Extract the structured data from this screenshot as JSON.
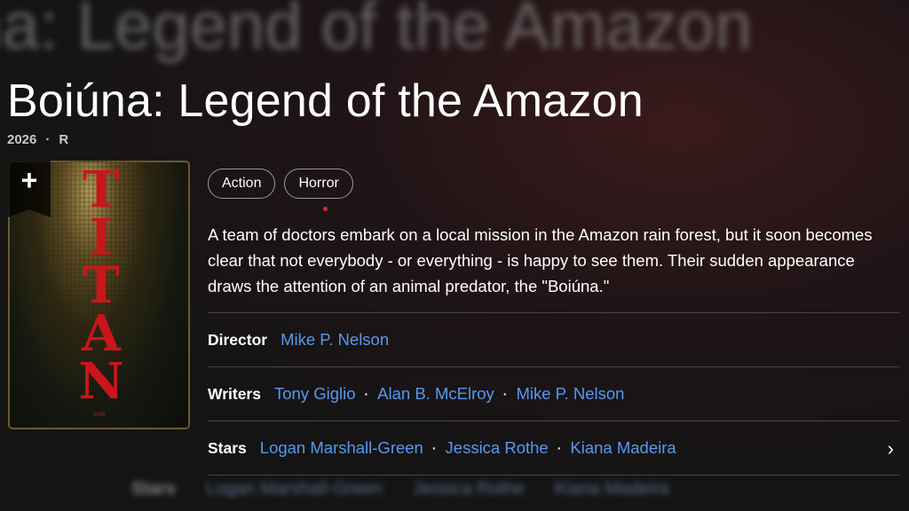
{
  "background_title": "na: Legend of the Amazon",
  "title": "Boiúna: Legend of the Amazon",
  "meta": {
    "year": "2026",
    "separator": "·",
    "rating": "R"
  },
  "poster": {
    "title_letters": [
      "T",
      "I",
      "T",
      "A",
      "N"
    ],
    "year": "2026",
    "watchlist_icon": "plus-icon"
  },
  "genres": [
    "Action",
    "Horror"
  ],
  "plot": "A team of doctors embark on a local mission in the Amazon rain forest, but it soon becomes clear that not everybody - or everything - is happy to see them. Their sudden appearance draws the attention of an animal predator, the \"Boiúna.\"",
  "credits": {
    "director": {
      "label": "Director",
      "names": [
        "Mike P. Nelson"
      ]
    },
    "writers": {
      "label": "Writers",
      "names": [
        "Tony Giglio",
        "Alan B. McElroy",
        "Mike P. Nelson"
      ]
    },
    "stars": {
      "label": "Stars",
      "names": [
        "Logan Marshall-Green",
        "Jessica Rothe",
        "Kiana Madeira"
      ]
    }
  },
  "ghost_row": {
    "label": "Stars",
    "names": [
      "Logan Marshall-Green",
      "Jessica Rothe",
      "Kiana Madeira"
    ]
  },
  "colors": {
    "link": "#5799ef",
    "accent_dot": "#e0262c",
    "background": "#141414"
  }
}
